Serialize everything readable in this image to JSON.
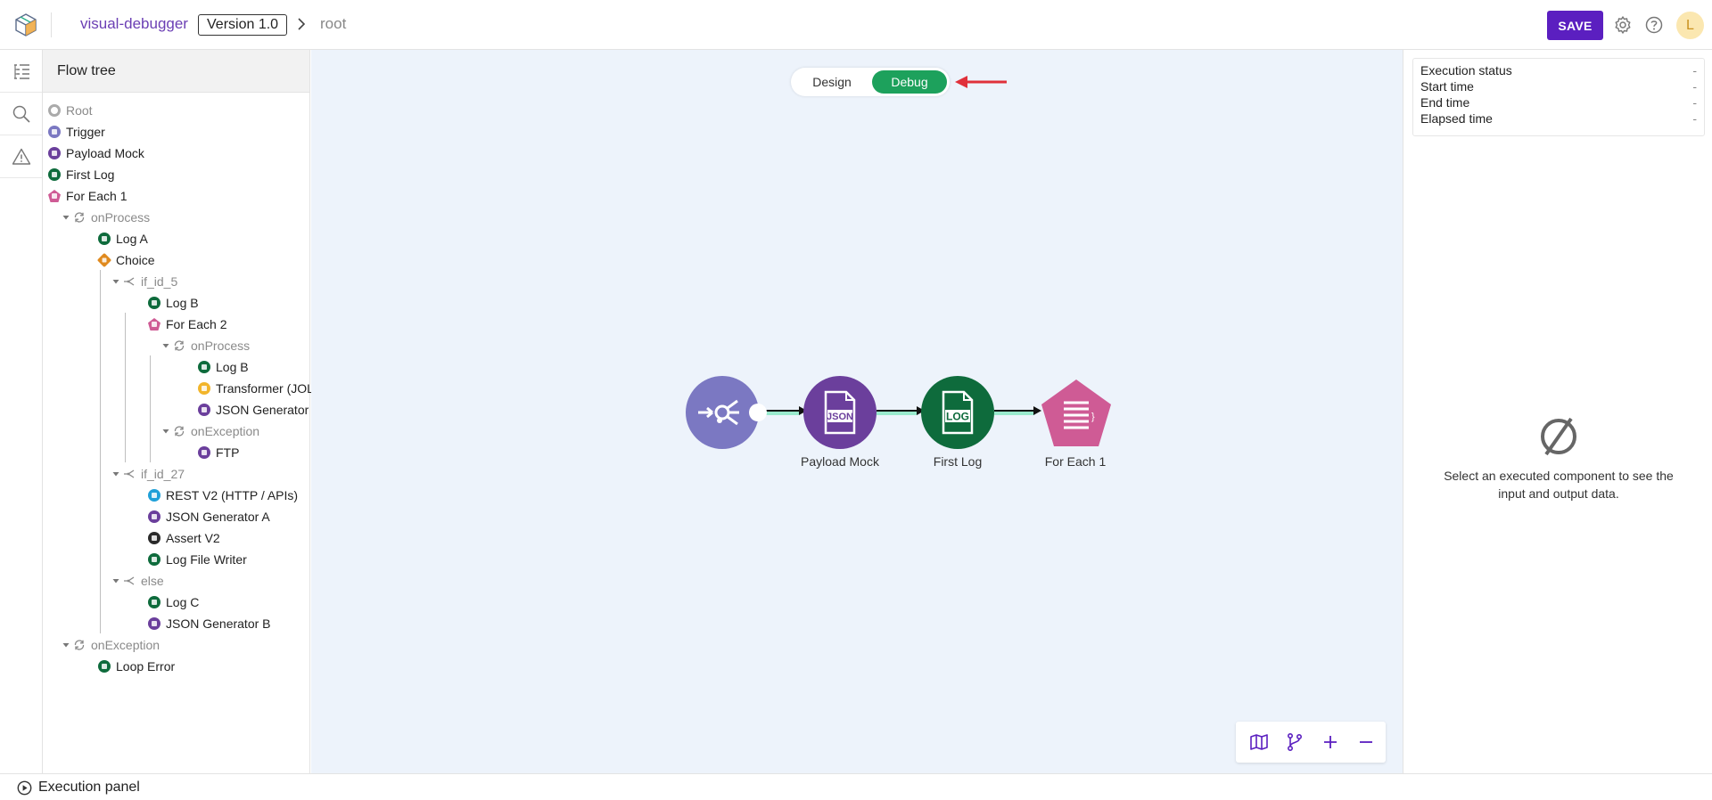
{
  "header": {
    "project": "visual-debugger",
    "version": "Version 1.0",
    "breadcrumb": "root",
    "save_label": "SAVE",
    "avatar_initial": "L"
  },
  "rail": {
    "items": [
      "flow-tree-icon",
      "search-icon",
      "warning-icon"
    ]
  },
  "tree": {
    "title": "Flow tree",
    "nodes": [
      {
        "label": "Root",
        "kind": "root",
        "depth": 0
      },
      {
        "label": "Trigger",
        "kind": "trigger",
        "depth": 0
      },
      {
        "label": "Payload Mock",
        "kind": "json",
        "depth": 0
      },
      {
        "label": "First Log",
        "kind": "log",
        "depth": 0
      },
      {
        "label": "For Each 1",
        "kind": "foreach",
        "depth": 0
      },
      {
        "label": "onProcess",
        "kind": "scope",
        "depth": 1
      },
      {
        "label": "Log A",
        "kind": "log",
        "depth": 2
      },
      {
        "label": "Choice",
        "kind": "choice",
        "depth": 2
      },
      {
        "label": "if_id_5",
        "kind": "branch",
        "depth": 3
      },
      {
        "label": "Log B",
        "kind": "log",
        "depth": 4
      },
      {
        "label": "For Each 2",
        "kind": "foreach",
        "depth": 4
      },
      {
        "label": "onProcess",
        "kind": "scope",
        "depth": 5
      },
      {
        "label": "Log B",
        "kind": "log",
        "depth": 6
      },
      {
        "label": "Transformer (JOLT)",
        "kind": "transformer",
        "depth": 6
      },
      {
        "label": "JSON Generator",
        "kind": "json",
        "depth": 6
      },
      {
        "label": "onException",
        "kind": "scope",
        "depth": 5
      },
      {
        "label": "FTP",
        "kind": "ftp",
        "depth": 6
      },
      {
        "label": "if_id_27",
        "kind": "branch",
        "depth": 3
      },
      {
        "label": "REST V2 (HTTP / APIs)",
        "kind": "rest",
        "depth": 4
      },
      {
        "label": "JSON Generator A",
        "kind": "json",
        "depth": 4
      },
      {
        "label": "Assert V2",
        "kind": "assert",
        "depth": 4
      },
      {
        "label": "Log File Writer",
        "kind": "log",
        "depth": 4
      },
      {
        "label": "else",
        "kind": "branch",
        "depth": 3
      },
      {
        "label": "Log C",
        "kind": "log",
        "depth": 4
      },
      {
        "label": "JSON Generator B",
        "kind": "json",
        "depth": 4
      },
      {
        "label": "onException",
        "kind": "scope",
        "depth": 1
      },
      {
        "label": "Loop Error",
        "kind": "log",
        "depth": 2
      }
    ]
  },
  "canvas": {
    "mode_design": "Design",
    "mode_debug": "Debug",
    "active_mode": "Debug",
    "nodes": [
      {
        "label": "",
        "kind": "trigger",
        "color": "#7b78c2"
      },
      {
        "label": "Payload Mock",
        "kind": "json",
        "color": "#6b3f9c",
        "icon_text": "JSON"
      },
      {
        "label": "First Log",
        "kind": "log",
        "color": "#0e6b3c",
        "icon_text": "LOG"
      },
      {
        "label": "For Each 1",
        "kind": "foreach",
        "color": "#cf5b95"
      }
    ],
    "zoom_controls": [
      "map-icon",
      "branch-icon",
      "zoom-in-icon",
      "zoom-out-icon"
    ]
  },
  "execution": {
    "rows": [
      {
        "label": "Execution status",
        "value": "-"
      },
      {
        "label": "Start time",
        "value": "-"
      },
      {
        "label": "End time",
        "value": "-"
      },
      {
        "label": "Elapsed time",
        "value": "-"
      }
    ],
    "empty_message": "Select an executed component to see the input and output data."
  },
  "footer": {
    "label": "Execution panel"
  },
  "colors": {
    "accent": "#5b1fc0",
    "debug": "#1da15c",
    "annotation_arrow": "#e0303a"
  }
}
